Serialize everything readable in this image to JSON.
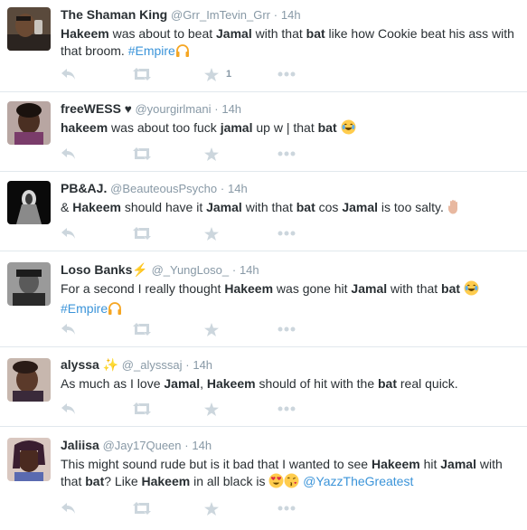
{
  "tweets": [
    {
      "name": "The Shaman King",
      "handle": "@Grr_ImTevin_Grr",
      "time": "14h",
      "segments": [
        {
          "t": "Hakeem",
          "b": true
        },
        {
          "t": " was about to beat "
        },
        {
          "t": "Jamal",
          "b": true
        },
        {
          "t": " with that "
        },
        {
          "t": "bat",
          "b": true
        },
        {
          "t": " like how Cookie beat his ass with that broom. "
        },
        {
          "t": "#Empire",
          "c": "hashtag"
        },
        {
          "e": "headphones"
        }
      ],
      "favorite_count": "1"
    },
    {
      "name": "freeWESS",
      "name_suffix": "heart",
      "handle": "@yourgirlmani",
      "time": "14h",
      "segments": [
        {
          "t": "hakeem",
          "b": true
        },
        {
          "t": " was about too fuck "
        },
        {
          "t": "jamal",
          "b": true
        },
        {
          "t": " up w | that "
        },
        {
          "t": "bat",
          "b": true
        },
        {
          "t": " "
        },
        {
          "e": "laugh-cry"
        }
      ],
      "favorite_count": ""
    },
    {
      "name": "PB&AJ.",
      "handle": "@BeauteousPsycho",
      "time": "14h",
      "segments": [
        {
          "t": "& "
        },
        {
          "t": "Hakeem",
          "b": true
        },
        {
          "t": " should have it "
        },
        {
          "t": "Jamal",
          "b": true
        },
        {
          "t": " with that "
        },
        {
          "t": "bat",
          "b": true
        },
        {
          "t": " cos "
        },
        {
          "t": "Jamal",
          "b": true
        },
        {
          "t": " is too salty. "
        },
        {
          "e": "raised-hand"
        }
      ],
      "favorite_count": ""
    },
    {
      "name": "Loso Banks",
      "name_suffix": "lightning",
      "handle": "@_YungLoso_",
      "time": "14h",
      "segments": [
        {
          "t": "For a second I really thought "
        },
        {
          "t": "Hakeem",
          "b": true
        },
        {
          "t": " was gone hit "
        },
        {
          "t": "Jamal",
          "b": true
        },
        {
          "t": " with that "
        },
        {
          "t": "bat",
          "b": true
        },
        {
          "t": " "
        },
        {
          "e": "laugh-cry"
        },
        {
          "br": true
        },
        {
          "t": "#Empire",
          "c": "hashtag"
        },
        {
          "e": "headphones"
        }
      ],
      "favorite_count": ""
    },
    {
      "name": "alyssa",
      "name_suffix": "sparkles",
      "handle": "@_alysssaj",
      "time": "14h",
      "segments": [
        {
          "t": "As much as I love "
        },
        {
          "t": "Jamal",
          "b": true
        },
        {
          "t": ", "
        },
        {
          "t": "Hakeem",
          "b": true
        },
        {
          "t": " should of hit with the "
        },
        {
          "t": "bat",
          "b": true
        },
        {
          "t": " real quick."
        }
      ],
      "favorite_count": ""
    },
    {
      "name": "Jaliisa",
      "handle": "@Jay17Queen",
      "time": "14h",
      "segments": [
        {
          "t": "This might sound rude but is it bad that I wanted to see "
        },
        {
          "t": "Hakeem",
          "b": true
        },
        {
          "t": " hit "
        },
        {
          "t": "Jamal",
          "b": true
        },
        {
          "t": " with that "
        },
        {
          "t": "bat",
          "b": true
        },
        {
          "t": "? Like "
        },
        {
          "t": "Hakeem",
          "b": true
        },
        {
          "t": " in all black is "
        },
        {
          "e": "heart-eyes"
        },
        {
          "e": "kiss"
        },
        {
          "t": " "
        },
        {
          "t": "@YazzTheGreatest",
          "c": "mention"
        }
      ],
      "favorite_count": ""
    }
  ],
  "icons": [
    "reply-icon",
    "retweet-icon",
    "favorite-icon",
    "more-icon"
  ],
  "colors": {
    "name": "#292f33",
    "meta": "#8899a6",
    "link": "#3b94d9",
    "action_icon": "#ccd6dd",
    "divider": "#e1e8ed"
  }
}
